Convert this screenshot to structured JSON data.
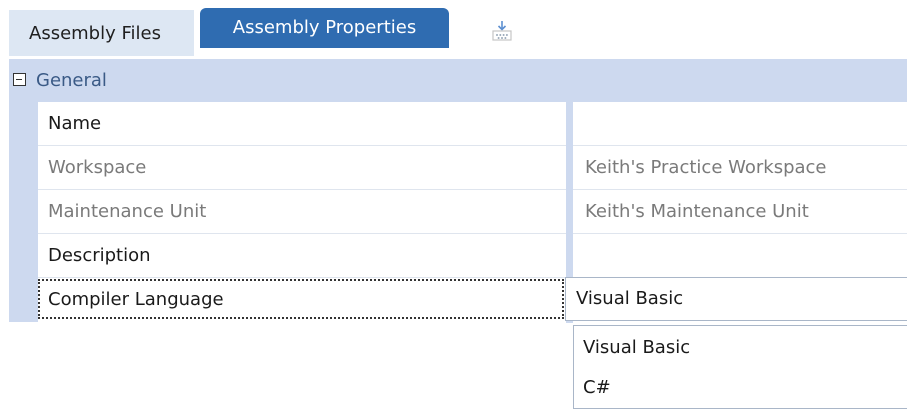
{
  "tabs": {
    "assembly_files": "Assembly Files",
    "assembly_properties": "Assembly Properties",
    "export_icon": "tray-download-icon"
  },
  "grid": {
    "group_label": "General",
    "rows": [
      {
        "label": "Name",
        "value": "",
        "muted": false
      },
      {
        "label": "Workspace",
        "value": "Keith's Practice Workspace",
        "muted": true
      },
      {
        "label": "Maintenance Unit",
        "value": "Keith's Maintenance Unit",
        "muted": true
      },
      {
        "label": "Description",
        "value": "",
        "muted": false
      },
      {
        "label": "Compiler Language",
        "value": "Visual Basic",
        "muted": false
      }
    ]
  },
  "compiler_dropdown": {
    "selected": "Visual Basic",
    "options": [
      "Visual Basic",
      "C#"
    ]
  },
  "colors": {
    "accent": "#2f6cb1",
    "grid_header": "#cdd9ef",
    "inactive_tab": "#dde7f3"
  }
}
